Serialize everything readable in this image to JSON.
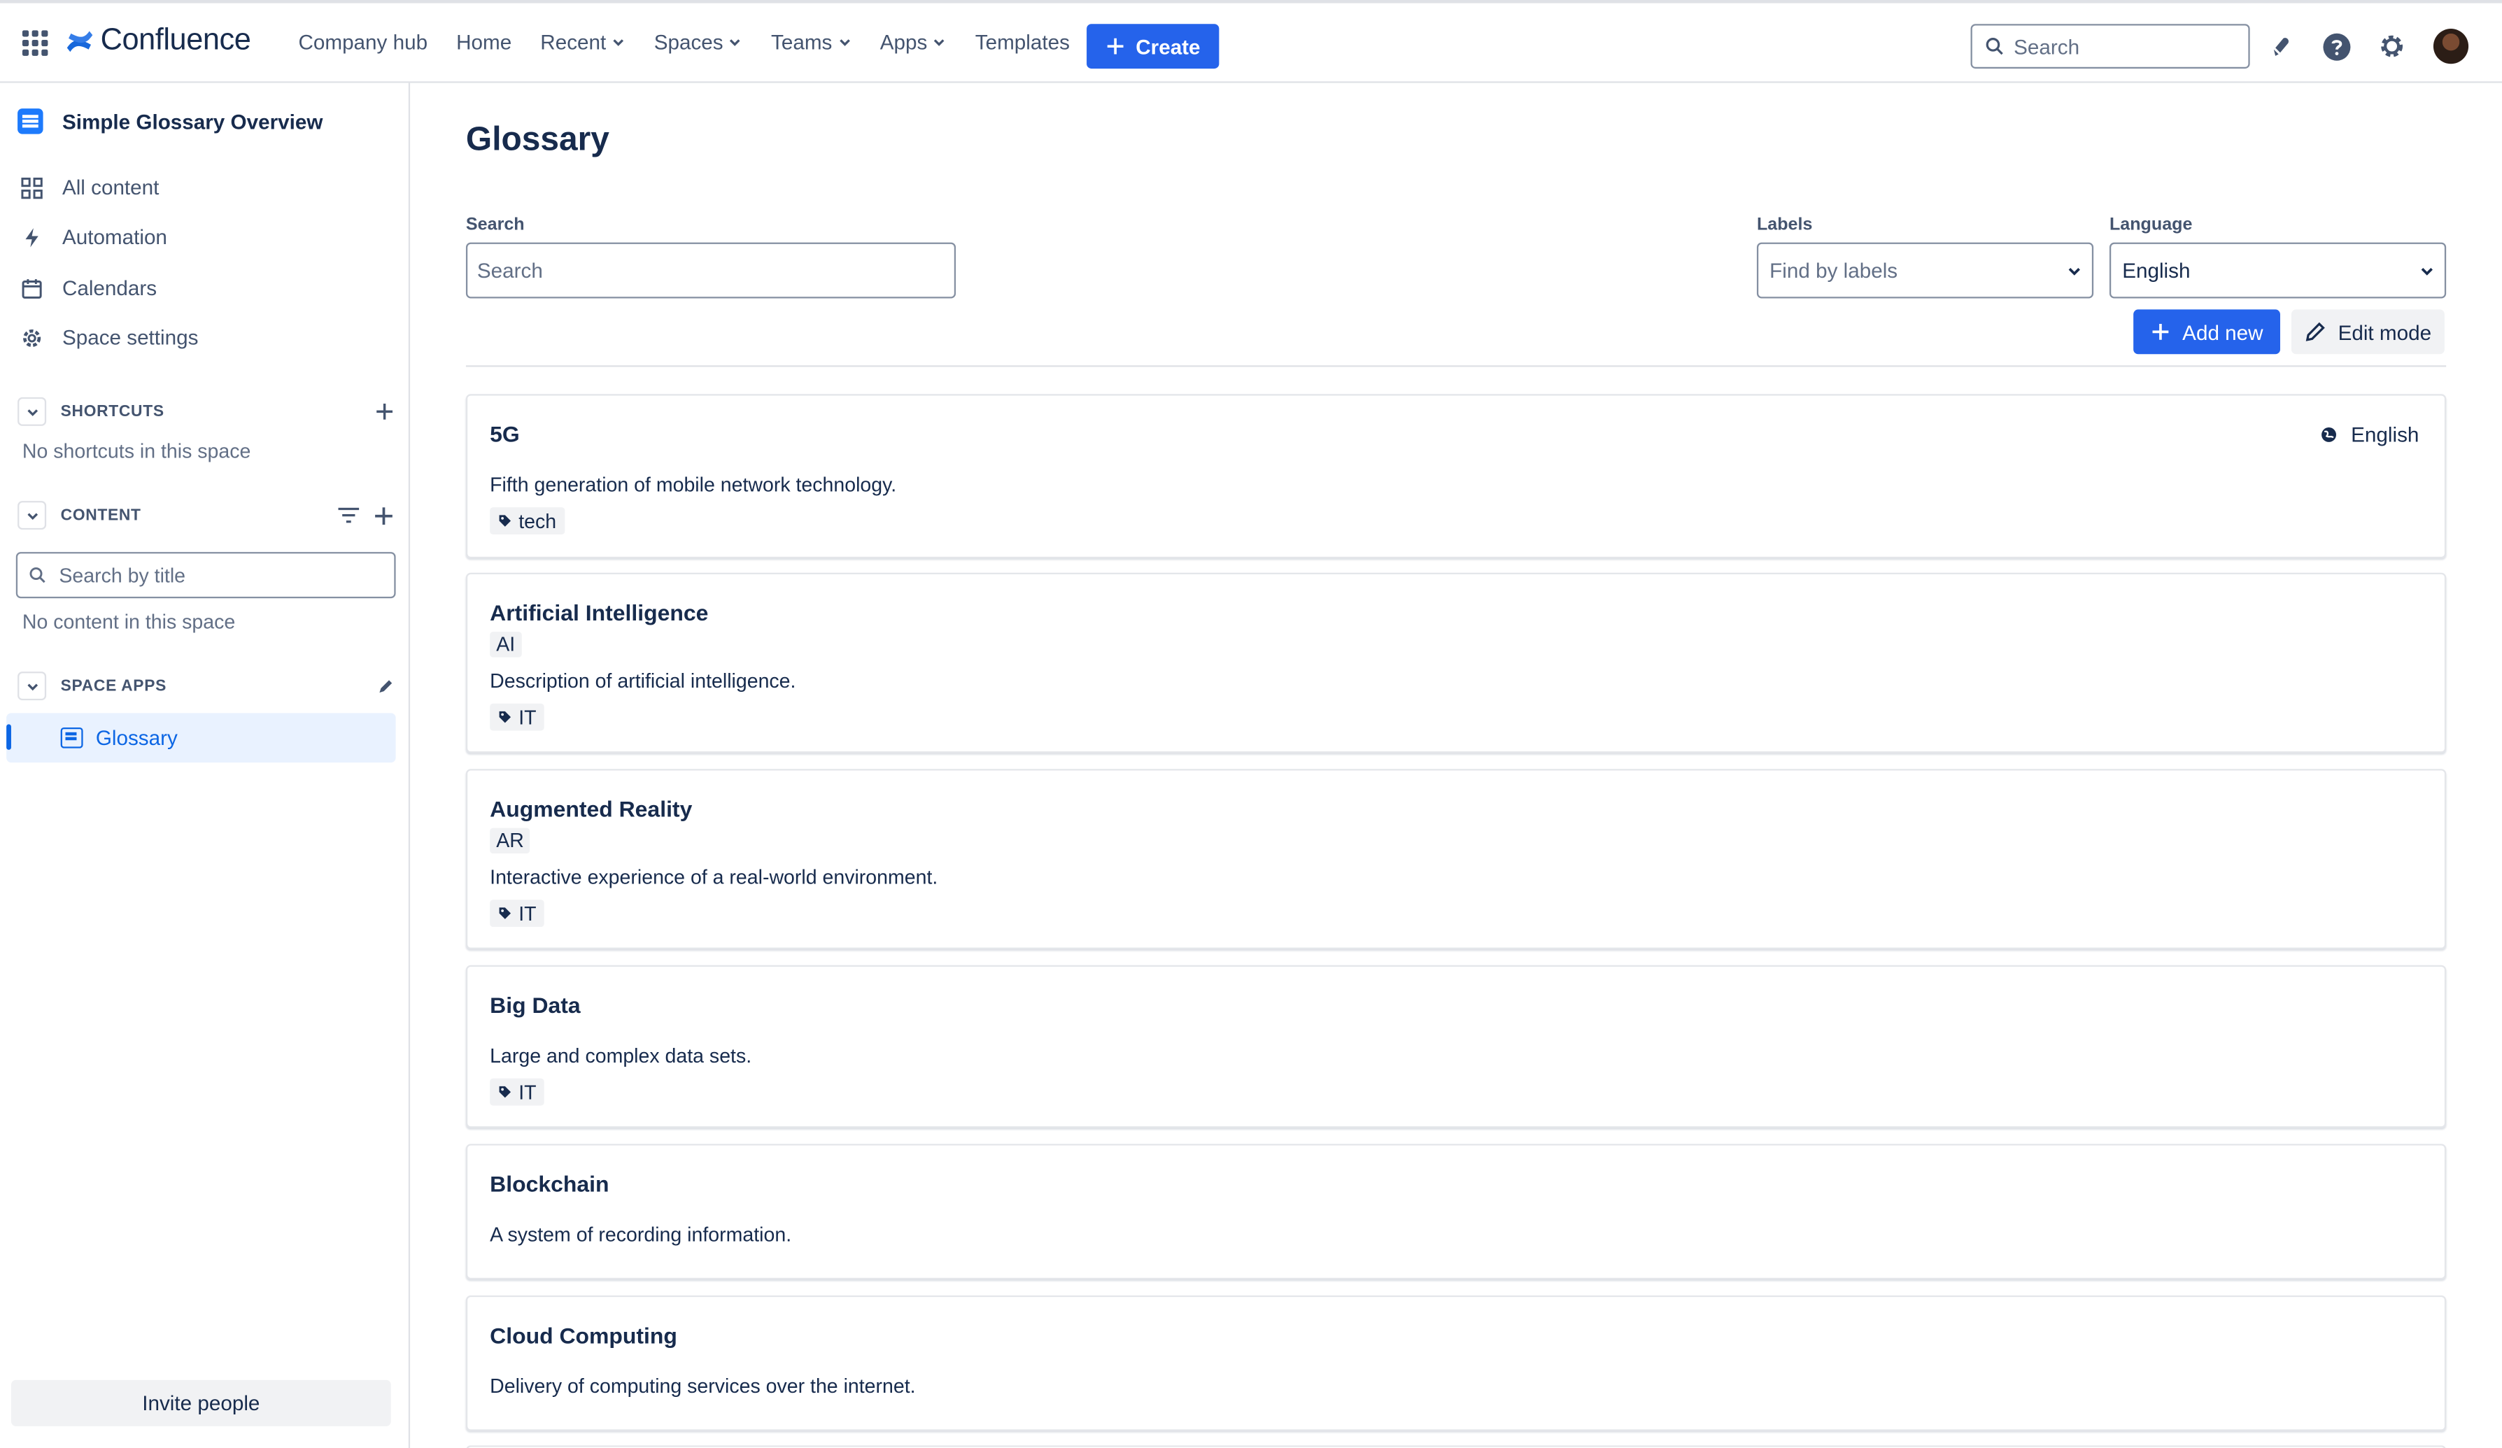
{
  "topnav": {
    "brand": "Confluence",
    "items": [
      {
        "label": "Company hub",
        "dropdown": false
      },
      {
        "label": "Home",
        "dropdown": false
      },
      {
        "label": "Recent",
        "dropdown": true
      },
      {
        "label": "Spaces",
        "dropdown": true
      },
      {
        "label": "Teams",
        "dropdown": true
      },
      {
        "label": "Apps",
        "dropdown": true
      },
      {
        "label": "Templates",
        "dropdown": false
      }
    ],
    "create_label": "Create",
    "search_placeholder": "Search",
    "icons": [
      "app-switcher-icon",
      "notifications-icon",
      "help-icon",
      "settings-icon",
      "avatar"
    ]
  },
  "sidebar": {
    "space_title": "Simple Glossary Overview",
    "links": [
      {
        "label": "All content",
        "icon": "grid-icon"
      },
      {
        "label": "Automation",
        "icon": "lightning-icon"
      },
      {
        "label": "Calendars",
        "icon": "calendar-icon"
      },
      {
        "label": "Space settings",
        "icon": "gear-icon"
      }
    ],
    "shortcuts": {
      "label": "SHORTCUTS",
      "empty": "No shortcuts in this space"
    },
    "content": {
      "label": "CONTENT",
      "search_placeholder": "Search by title",
      "empty": "No content in this space"
    },
    "space_apps": {
      "label": "SPACE APPS",
      "items": [
        {
          "label": "Glossary"
        }
      ]
    },
    "invite_label": "Invite people"
  },
  "main": {
    "title": "Glossary",
    "search": {
      "label": "Search",
      "placeholder": "Search"
    },
    "labels": {
      "label": "Labels",
      "placeholder": "Find by labels"
    },
    "language": {
      "label": "Language",
      "value": "English"
    },
    "add_new_label": "Add new",
    "edit_mode_label": "Edit mode",
    "entries": [
      {
        "term": "5G",
        "abbr": "",
        "description": "Fifth generation of mobile network technology.",
        "tag": "tech",
        "language": "English"
      },
      {
        "term": "Artificial Intelligence",
        "abbr": "AI",
        "description": "Description of artificial intelligence.",
        "tag": "IT",
        "language": ""
      },
      {
        "term": "Augmented Reality",
        "abbr": "AR",
        "description": "Interactive experience of a real-world environment.",
        "tag": "IT",
        "language": ""
      },
      {
        "term": "Big Data",
        "abbr": "",
        "description": "Large and complex data sets.",
        "tag": "IT",
        "language": ""
      },
      {
        "term": "Blockchain",
        "abbr": "",
        "description": "A system of recording information.",
        "tag": "",
        "language": ""
      },
      {
        "term": "Cloud Computing",
        "abbr": "",
        "description": "Delivery of computing services over the internet.",
        "tag": "",
        "language": ""
      }
    ]
  },
  "colors": {
    "accent": "#2563eb",
    "selected_bg": "#e9f2ff",
    "selected_text": "#0c66e4",
    "text": "#172b4d",
    "muted": "#44546f"
  }
}
